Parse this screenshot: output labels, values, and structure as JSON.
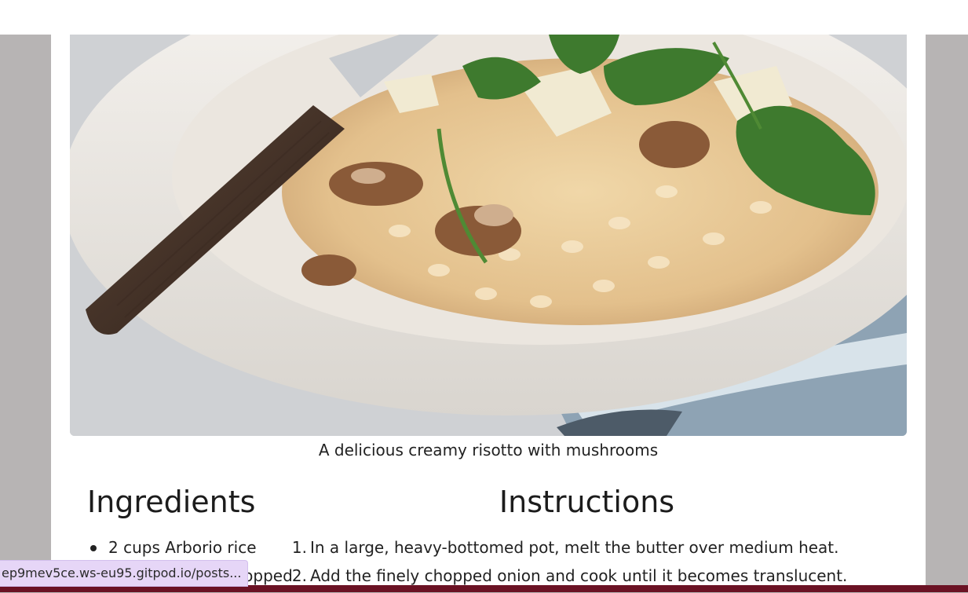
{
  "recipe": {
    "image_alt": "A delicious creamy risotto with mushrooms",
    "caption": "A delicious creamy risotto with mushrooms",
    "ingredients_heading": "Ingredients",
    "instructions_heading": "Instructions",
    "ingredients": [
      "2 cups Arborio rice",
      "1 onion, finely chopped"
    ],
    "instructions": [
      {
        "num": "1.",
        "text": "In a large, heavy-bottomed pot, melt the butter over medium heat."
      },
      {
        "num": "2.",
        "text": "Add the finely chopped onion and cook until it becomes translucent."
      }
    ]
  },
  "status_bar": {
    "url": "ep9mev5ce.ws-eu95.gitpod.io/posts..."
  },
  "colors": {
    "background": "#b7b4b4",
    "page": "#ffffff",
    "status_bg": "#e6d6f7",
    "bottom_strip": "#6b1224"
  }
}
